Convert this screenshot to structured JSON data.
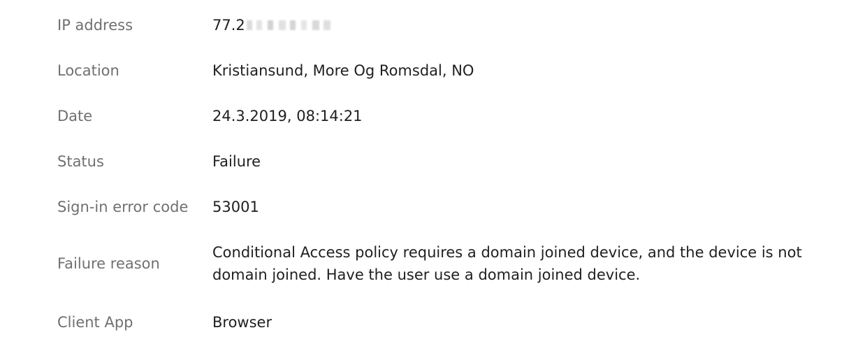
{
  "details": {
    "ip_address": {
      "label": "IP address",
      "value": "77.2"
    },
    "location": {
      "label": "Location",
      "value": "Kristiansund, More Og Romsdal, NO"
    },
    "date": {
      "label": "Date",
      "value": "24.3.2019, 08:14:21"
    },
    "status": {
      "label": "Status",
      "value": "Failure"
    },
    "error_code": {
      "label": "Sign-in error code",
      "value": "53001"
    },
    "failure_reason": {
      "label": "Failure reason",
      "value": "Conditional Access policy requires a domain joined device, and the device is not domain joined. Have the user use a domain joined device."
    },
    "client_app": {
      "label": "Client App",
      "value": "Browser"
    }
  }
}
